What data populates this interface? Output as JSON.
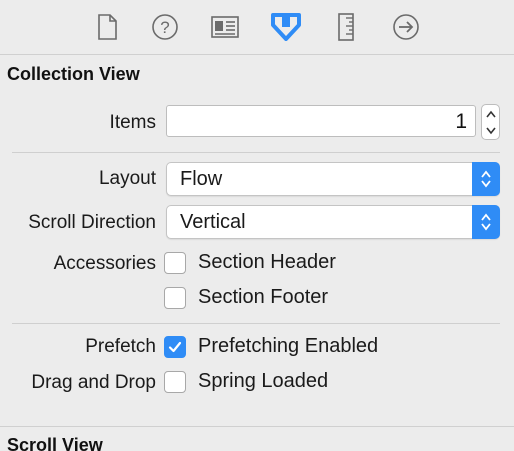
{
  "toolbar": {
    "icons": [
      {
        "name": "file-inspector-icon"
      },
      {
        "name": "quick-help-icon"
      },
      {
        "name": "identity-inspector-icon"
      },
      {
        "name": "attributes-inspector-icon",
        "selected": true,
        "color": "#2f8cf6"
      },
      {
        "name": "size-inspector-icon"
      },
      {
        "name": "connections-inspector-icon"
      }
    ]
  },
  "collection_view": {
    "title": "Collection View",
    "items": {
      "label": "Items",
      "value": "1"
    },
    "layout": {
      "label": "Layout",
      "value": "Flow"
    },
    "scroll_direction": {
      "label": "Scroll Direction",
      "value": "Vertical"
    },
    "accessories": {
      "label": "Accessories",
      "section_header": {
        "label": "Section Header",
        "checked": false
      },
      "section_footer": {
        "label": "Section Footer",
        "checked": false
      }
    },
    "prefetch": {
      "label": "Prefetch",
      "option": {
        "label": "Prefetching Enabled",
        "checked": true
      }
    },
    "drag_and_drop": {
      "label": "Drag and Drop",
      "option": {
        "label": "Spring Loaded",
        "checked": false
      }
    }
  },
  "next_section": {
    "title": "Scroll View"
  },
  "colors": {
    "accent": "#2f8cf6",
    "background": "#ececec"
  }
}
